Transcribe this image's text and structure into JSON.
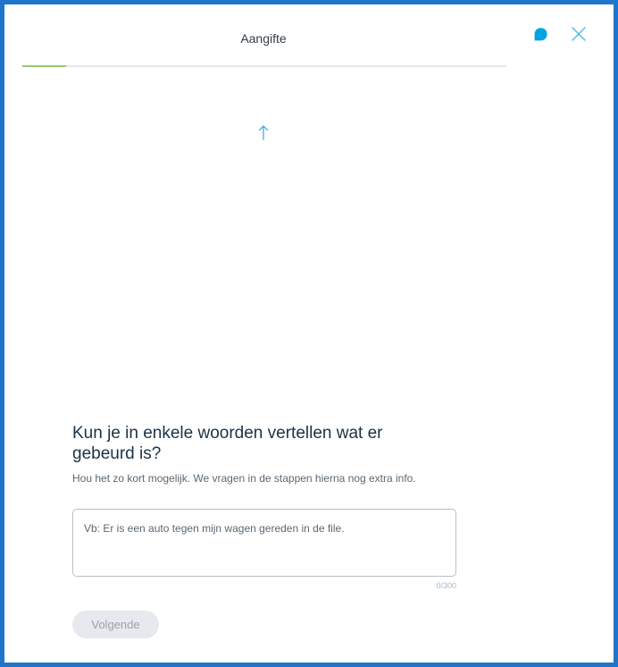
{
  "header": {
    "title": "Aangifte",
    "icons": [
      "chat-icon",
      "close-icon"
    ]
  },
  "progress": {
    "fraction": 0.09,
    "fill_color": "#8ccd6b",
    "track_color": "#e3e6ea"
  },
  "form": {
    "question": "Kun je in enkele woorden vertellen wat er gebeurd is?",
    "hint": "Hou het zo kort mogelijk. We vragen in de stappen hierna nog extra info.",
    "placeholder": "Vb: Er is een auto tegen mijn wagen gereden in de file.",
    "counter": "0/300",
    "next_label": "Volgende"
  },
  "colors": {
    "frame_border": "#1f74cc",
    "accent": "#00a3e0"
  }
}
